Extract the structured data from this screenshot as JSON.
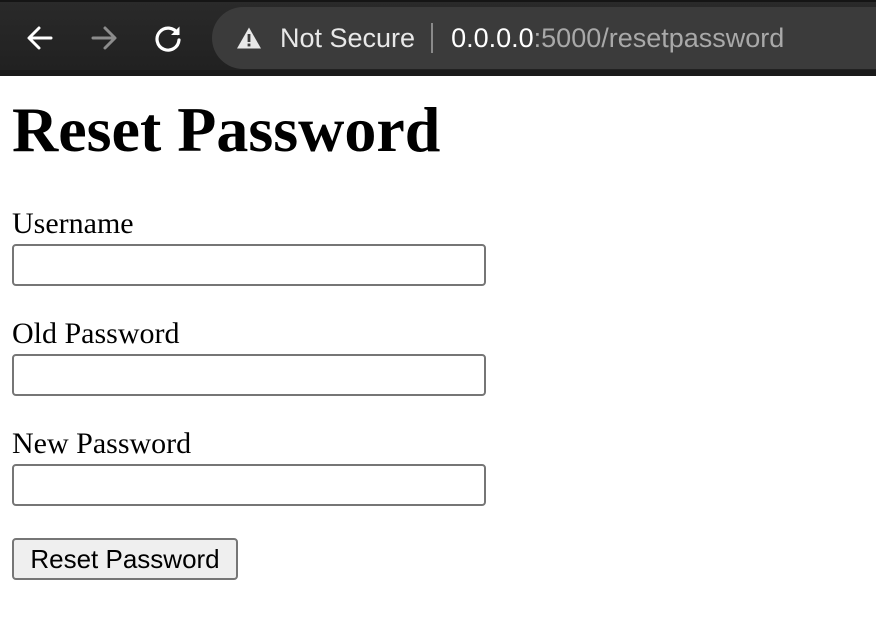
{
  "browser": {
    "back_icon": "arrow-left-icon",
    "forward_icon": "arrow-right-icon",
    "reload_icon": "reload-icon",
    "security_icon": "warning-triangle-icon",
    "security_text": "Not Secure",
    "url_host": "0.0.0.0",
    "url_rest": ":5000/resetpassword"
  },
  "page": {
    "title": "Reset Password",
    "fields": {
      "username": {
        "label": "Username",
        "value": ""
      },
      "old_password": {
        "label": "Old Password",
        "value": ""
      },
      "new_password": {
        "label": "New Password",
        "value": ""
      }
    },
    "submit_label": "Reset Password"
  },
  "colors": {
    "toolbar_bg": "#202020",
    "omnibox_bg": "#3b3b3b",
    "url_host": "#ffffff",
    "url_rest": "#a9a9a9",
    "button_bg": "#efefef",
    "input_border": "#767676"
  }
}
